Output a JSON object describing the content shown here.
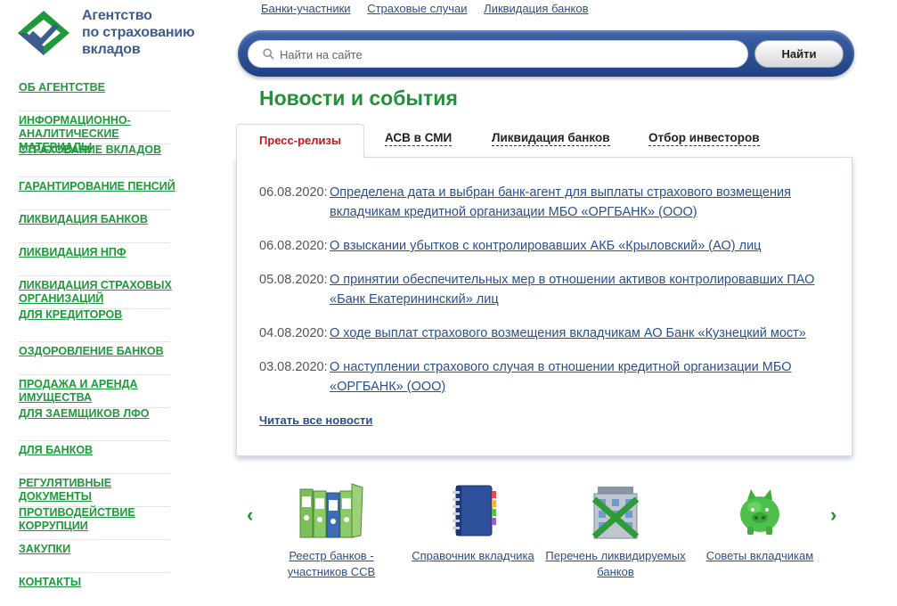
{
  "logo": {
    "line1": "Агентство",
    "line2": "по страхованию",
    "line3": "вкладов"
  },
  "sidebar": {
    "items": [
      {
        "label": "ОБ АГЕНТСТВЕ"
      },
      {
        "label": "ИНФОРМАЦИОННО-\nАНАЛИТИЧЕСКИЕ МАТЕРИАЛЫ"
      },
      {
        "label": "СТРАХОВАНИЕ ВКЛАДОВ"
      },
      {
        "label": "ГАРАНТИРОВАНИЕ ПЕНСИЙ"
      },
      {
        "label": "ЛИКВИДАЦИЯ БАНКОВ"
      },
      {
        "label": "ЛИКВИДАЦИЯ НПФ"
      },
      {
        "label": "ЛИКВИДАЦИЯ СТРАХОВЫХ\nОРГАНИЗАЦИЙ"
      },
      {
        "label": "ДЛЯ КРЕДИТОРОВ"
      },
      {
        "label": "ОЗДОРОВЛЕНИЕ БАНКОВ"
      },
      {
        "label": "ПРОДАЖА И АРЕНДА\nИМУЩЕСТВА"
      },
      {
        "label": "ДЛЯ ЗАЕМЩИКОВ ЛФО"
      },
      {
        "label": "ДЛЯ БАНКОВ"
      },
      {
        "label": "РЕГУЛЯТИВНЫЕ\nДОКУМЕНТЫ"
      },
      {
        "label": "ПРОТИВОДЕЙСТВИЕ\nКОРРУПЦИИ"
      },
      {
        "label": "ЗАКУПКИ"
      },
      {
        "label": "КОНТАКТЫ"
      }
    ]
  },
  "top_links": [
    "Банки-участники",
    "Страховые случаи",
    "Ликвидация банков"
  ],
  "search": {
    "placeholder": "Найти на сайте",
    "button": "Найти"
  },
  "page_title": "Новости и события",
  "tabs": [
    "Пресс-релизы",
    "АСВ в СМИ",
    "Ликвидация банков",
    "Отбор инвесторов"
  ],
  "news": [
    {
      "date": "06.08.2020:",
      "title": "Определена дата и выбран банк-агент для выплаты страхового возмещения вкладчикам кредитной организации МБО «ОРГБАНК» (ООО)"
    },
    {
      "date": "06.08.2020:",
      "title": "О взыскании убытков с контролировавших АКБ «Крыловский» (АО) лиц"
    },
    {
      "date": "05.08.2020:",
      "title": "О принятии обеспечительных мер в отношении активов контролировавших ПАО «Банк Екатерининский» лиц"
    },
    {
      "date": "04.08.2020:",
      "title": "О ходе выплат страхового возмещения вкладчикам АО Банк «Кузнецкий мост»"
    },
    {
      "date": "03.08.2020:",
      "title": "О наступлении страхового случая в отношении кредитной организации МБО «ОРГБАНК» (ООО)"
    }
  ],
  "read_all": "Читать все новости",
  "carousel": {
    "prev_icon": "chevron-left-icon",
    "next_icon": "chevron-right-icon",
    "items": [
      {
        "label": "Реестр банков - участников ССВ",
        "icon": "binders-icon"
      },
      {
        "label": "Справочник вкладчика",
        "icon": "notebook-icon"
      },
      {
        "label": "Перечень ликвидируемых банков",
        "icon": "closed-bank-icon"
      },
      {
        "label": "Советы вкладчикам",
        "icon": "piggy-bank-icon"
      }
    ],
    "arrow_prev": "‹",
    "arrow_next": "›"
  },
  "colors": {
    "brand_green": "#22923a",
    "brand_blue": "#2a4f8f",
    "active_tab": "#c4161c"
  }
}
